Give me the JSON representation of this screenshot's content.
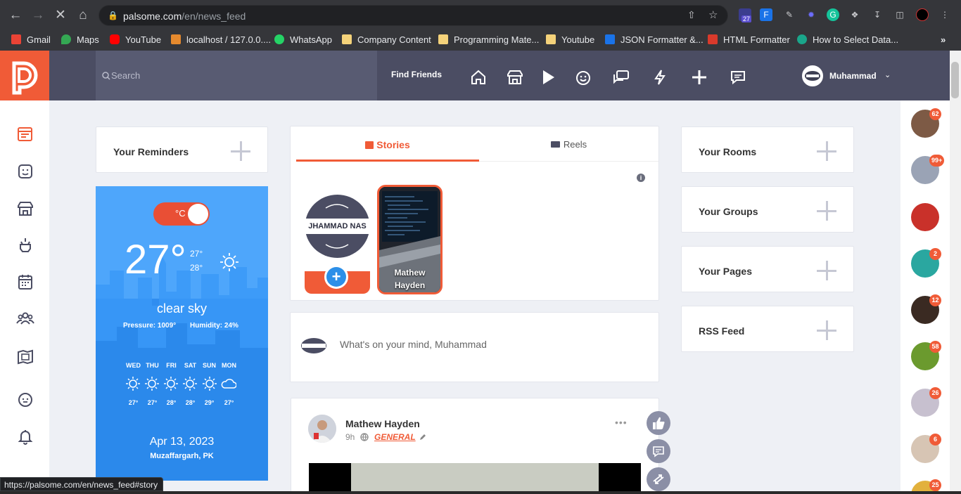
{
  "browser": {
    "url_host": "palsome.com",
    "url_path": "/en/news_feed",
    "extension_badge": "27",
    "bookmarks": [
      "Gmail",
      "Maps",
      "YouTube",
      "localhost / 127.0.0....",
      "WhatsApp",
      "Company Content",
      "Programming Mate...",
      "Youtube",
      "JSON Formatter &...",
      "HTML Formatter",
      "How to Select Data..."
    ]
  },
  "header": {
    "search_placeholder": "Search",
    "find_friends": "Find Friends",
    "user_name": "Muhammad"
  },
  "left_widgets": {
    "reminders_title": "Your Reminders"
  },
  "weather": {
    "unit": "°C",
    "temperature": "27°",
    "high": "27°",
    "low": "28°",
    "condition": "clear sky",
    "pressure": "Pressure: 1009°",
    "humidity": "Humidity: 24%",
    "days": [
      {
        "name": "WED",
        "temp": "27°",
        "icon": "sun-icon"
      },
      {
        "name": "THU",
        "temp": "27°",
        "icon": "sun-icon"
      },
      {
        "name": "FRI",
        "temp": "28°",
        "icon": "sun-icon"
      },
      {
        "name": "SAT",
        "temp": "28°",
        "icon": "sun-icon"
      },
      {
        "name": "SUN",
        "temp": "29°",
        "icon": "sun-icon"
      },
      {
        "name": "MON",
        "temp": "27°",
        "icon": "cloud-icon"
      }
    ],
    "date": "Apr 13, 2023",
    "location": "Muzaffargarh, PK"
  },
  "stories": {
    "tab_stories": "Stories",
    "tab_reels": "Reels",
    "my_story_banner": "JHAMMAD NAS",
    "other_story_name": "Mathew Hayden"
  },
  "composer": {
    "placeholder": "What's on your mind, Muhammad"
  },
  "post": {
    "author": "Mathew Hayden",
    "time": "9h",
    "category": "GENERAL"
  },
  "right_widgets": {
    "rooms": "Your Rooms",
    "groups": "Your Groups",
    "pages": "Your Pages",
    "rss": "RSS Feed"
  },
  "contacts": [
    {
      "badge": "62",
      "color": "#7d5a45"
    },
    {
      "badge": "99+",
      "color": "#9aa3b5"
    },
    {
      "badge": "",
      "color": "#c9312a"
    },
    {
      "badge": "2",
      "color": "#2aa7a0"
    },
    {
      "badge": "12",
      "color": "#3a2a22"
    },
    {
      "badge": "58",
      "color": "#6b9a2e"
    },
    {
      "badge": "26",
      "color": "#c7c0cf"
    },
    {
      "badge": "6",
      "color": "#d7c5b4"
    },
    {
      "badge": "25",
      "color": "#e2b13c"
    }
  ],
  "status_url": "https://palsome.com/en/news_feed#story",
  "colors": {
    "accent": "#f05b37",
    "appbar": "#4b4d63",
    "weather": "#2f8df0"
  }
}
